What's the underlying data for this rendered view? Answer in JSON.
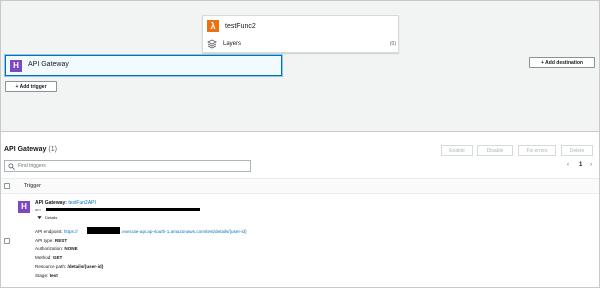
{
  "designer": {
    "function_name": "testFunc2",
    "layers_label": "Layers",
    "layers_count": "(0)",
    "trigger_card_label": "API Gateway",
    "add_trigger_label": "+ Add trigger",
    "add_destination_label": "+ Add destination"
  },
  "panel": {
    "title": "API Gateway",
    "count": "(1)",
    "buttons": {
      "enable": "Enable",
      "disable": "Disable",
      "fix_errors": "Fix errors",
      "delete": "Delete"
    },
    "search_placeholder": "Find triggers",
    "pager": {
      "prev": "‹",
      "page": "1",
      "next": "›"
    },
    "column_trigger": "Trigger"
  },
  "row": {
    "title_prefix": "API Gateway: ",
    "api_name": "testFun2API",
    "arn_label": "arn",
    "details_label": "Details",
    "endpoint_label": "API endpoint: ",
    "endpoint_prefix": "https://",
    "endpoint_rest": ".execute-api.ap-south-1.amazonaws.com/test/details/{user-id}",
    "api_type_label": "API type: ",
    "api_type": "REST",
    "auth_label": "Authorization: ",
    "auth": "NONE",
    "method_label": "Method: ",
    "method": "GET",
    "resource_label": "Resource path: ",
    "resource": "/details/{user-id}",
    "stage_label": "Stage: ",
    "stage": "test"
  },
  "colors": {
    "accent": "#0073bb",
    "lambda": "#ec7211",
    "api_gateway": "#7b4ac2"
  }
}
